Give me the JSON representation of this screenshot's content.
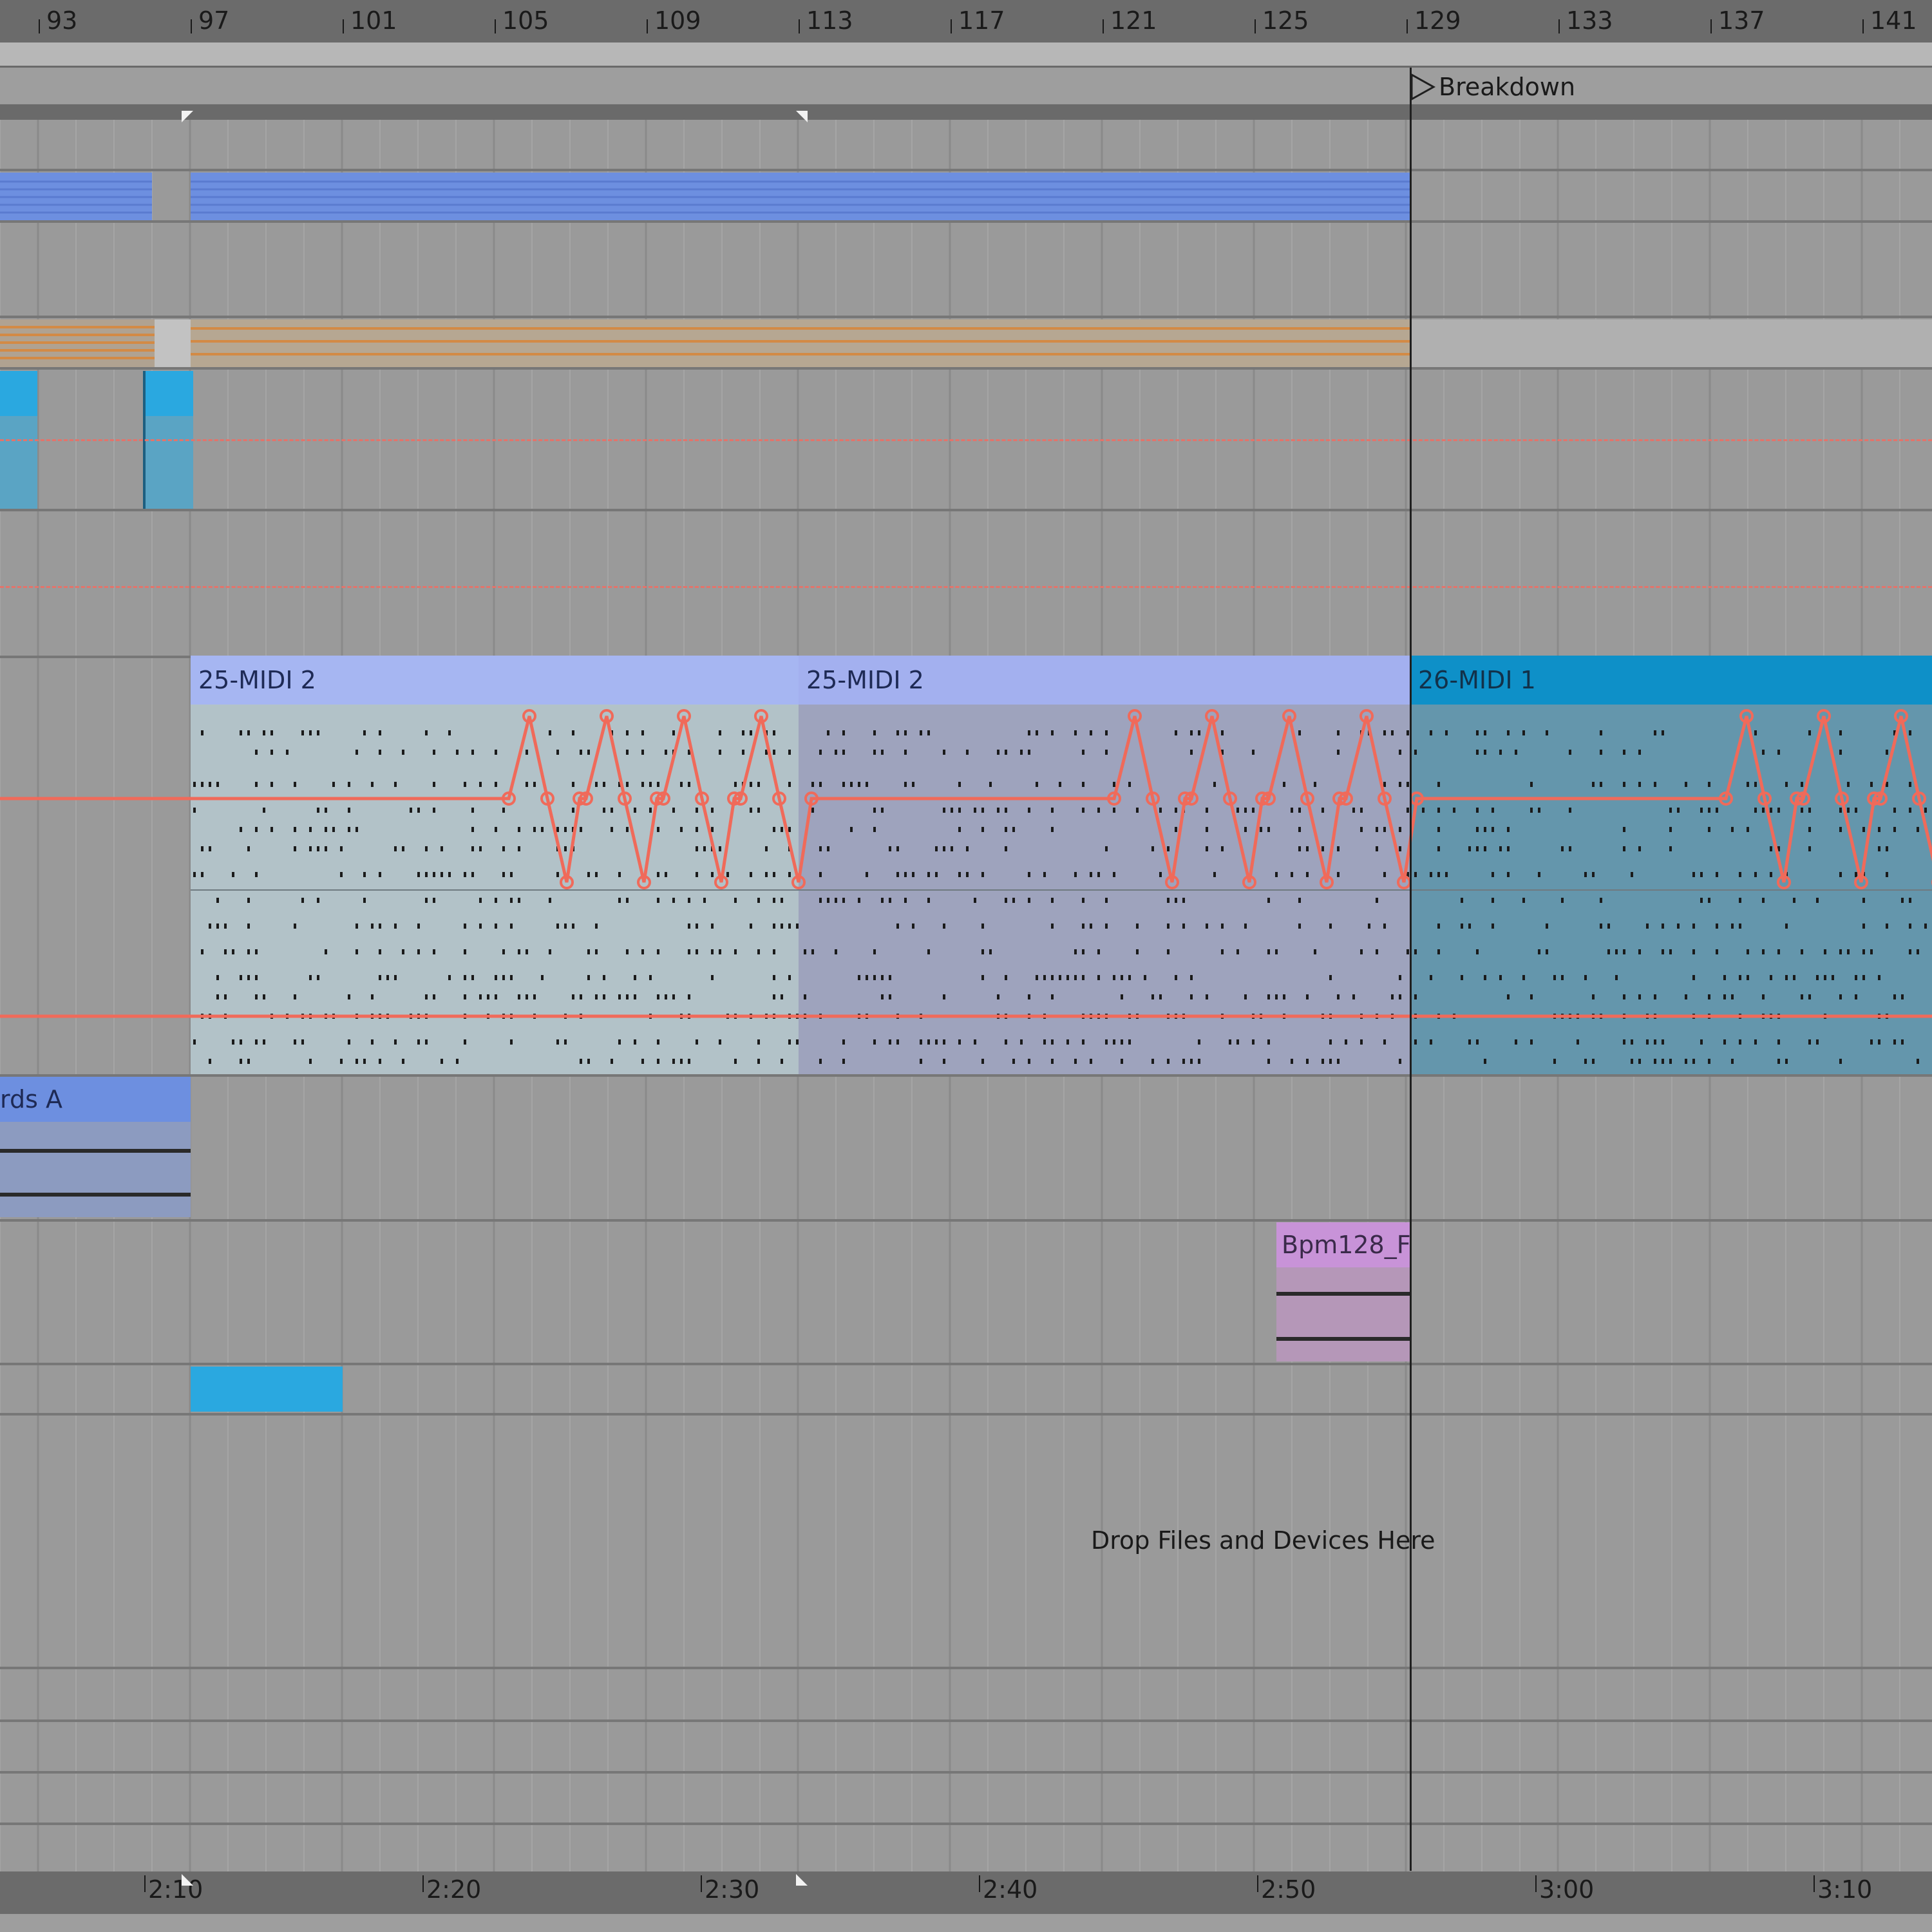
{
  "ruler": {
    "bars": [
      "93",
      "97",
      "101",
      "105",
      "109",
      "113",
      "117",
      "121",
      "125",
      "129",
      "133",
      "137",
      "141"
    ]
  },
  "locator": {
    "label": "Breakdown"
  },
  "clips": {
    "midi_a": {
      "title": "25-MIDI 2"
    },
    "midi_b": {
      "title": "25-MIDI 2"
    },
    "midi_c": {
      "title": "26-MIDI 1"
    },
    "audio_chords": {
      "title": "rds A"
    },
    "audio_bpm": {
      "title": "Bpm128_F"
    }
  },
  "drop_zone": {
    "text": "Drop Files and Devices Here"
  },
  "time_ruler": {
    "labels": [
      "2:10",
      "2:20",
      "2:30",
      "2:40",
      "2:50",
      "3:00",
      "3:10"
    ]
  },
  "colors": {
    "background": "#9a9a9a",
    "ruler": "#6b6b6b",
    "clip_blue": "#6d8fe0",
    "clip_lavender": "#a6b6f2",
    "clip_cyan": "#0e90c8",
    "clip_cyan_small": "#2aa8e0",
    "clip_pink": "#c893d8",
    "automation": "#f06a5a",
    "playhead": "#1f1f1f"
  }
}
